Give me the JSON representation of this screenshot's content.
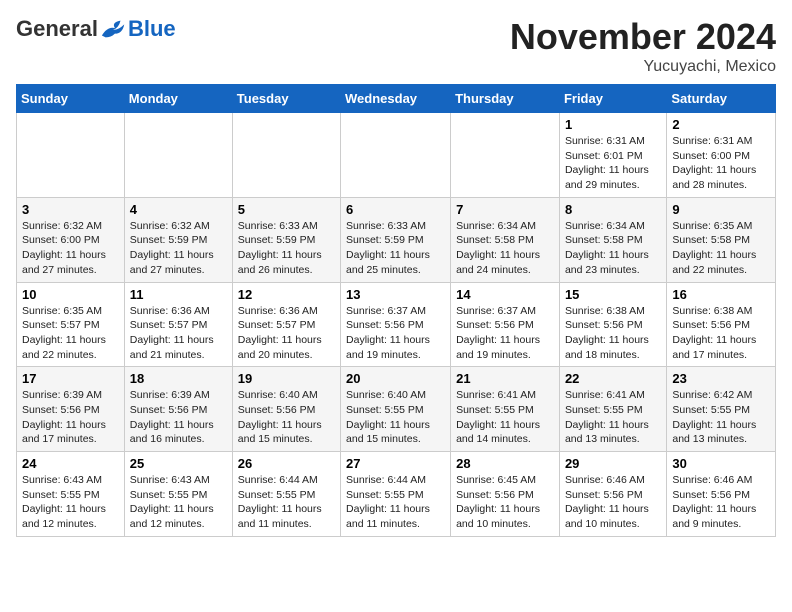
{
  "logo": {
    "general": "General",
    "blue": "Blue"
  },
  "title": "November 2024",
  "location": "Yucuyachi, Mexico",
  "days_header": [
    "Sunday",
    "Monday",
    "Tuesday",
    "Wednesday",
    "Thursday",
    "Friday",
    "Saturday"
  ],
  "weeks": [
    [
      {
        "day": "",
        "info": ""
      },
      {
        "day": "",
        "info": ""
      },
      {
        "day": "",
        "info": ""
      },
      {
        "day": "",
        "info": ""
      },
      {
        "day": "",
        "info": ""
      },
      {
        "day": "1",
        "info": "Sunrise: 6:31 AM\nSunset: 6:01 PM\nDaylight: 11 hours and 29 minutes."
      },
      {
        "day": "2",
        "info": "Sunrise: 6:31 AM\nSunset: 6:00 PM\nDaylight: 11 hours and 28 minutes."
      }
    ],
    [
      {
        "day": "3",
        "info": "Sunrise: 6:32 AM\nSunset: 6:00 PM\nDaylight: 11 hours and 27 minutes."
      },
      {
        "day": "4",
        "info": "Sunrise: 6:32 AM\nSunset: 5:59 PM\nDaylight: 11 hours and 27 minutes."
      },
      {
        "day": "5",
        "info": "Sunrise: 6:33 AM\nSunset: 5:59 PM\nDaylight: 11 hours and 26 minutes."
      },
      {
        "day": "6",
        "info": "Sunrise: 6:33 AM\nSunset: 5:59 PM\nDaylight: 11 hours and 25 minutes."
      },
      {
        "day": "7",
        "info": "Sunrise: 6:34 AM\nSunset: 5:58 PM\nDaylight: 11 hours and 24 minutes."
      },
      {
        "day": "8",
        "info": "Sunrise: 6:34 AM\nSunset: 5:58 PM\nDaylight: 11 hours and 23 minutes."
      },
      {
        "day": "9",
        "info": "Sunrise: 6:35 AM\nSunset: 5:58 PM\nDaylight: 11 hours and 22 minutes."
      }
    ],
    [
      {
        "day": "10",
        "info": "Sunrise: 6:35 AM\nSunset: 5:57 PM\nDaylight: 11 hours and 22 minutes."
      },
      {
        "day": "11",
        "info": "Sunrise: 6:36 AM\nSunset: 5:57 PM\nDaylight: 11 hours and 21 minutes."
      },
      {
        "day": "12",
        "info": "Sunrise: 6:36 AM\nSunset: 5:57 PM\nDaylight: 11 hours and 20 minutes."
      },
      {
        "day": "13",
        "info": "Sunrise: 6:37 AM\nSunset: 5:56 PM\nDaylight: 11 hours and 19 minutes."
      },
      {
        "day": "14",
        "info": "Sunrise: 6:37 AM\nSunset: 5:56 PM\nDaylight: 11 hours and 19 minutes."
      },
      {
        "day": "15",
        "info": "Sunrise: 6:38 AM\nSunset: 5:56 PM\nDaylight: 11 hours and 18 minutes."
      },
      {
        "day": "16",
        "info": "Sunrise: 6:38 AM\nSunset: 5:56 PM\nDaylight: 11 hours and 17 minutes."
      }
    ],
    [
      {
        "day": "17",
        "info": "Sunrise: 6:39 AM\nSunset: 5:56 PM\nDaylight: 11 hours and 17 minutes."
      },
      {
        "day": "18",
        "info": "Sunrise: 6:39 AM\nSunset: 5:56 PM\nDaylight: 11 hours and 16 minutes."
      },
      {
        "day": "19",
        "info": "Sunrise: 6:40 AM\nSunset: 5:56 PM\nDaylight: 11 hours and 15 minutes."
      },
      {
        "day": "20",
        "info": "Sunrise: 6:40 AM\nSunset: 5:55 PM\nDaylight: 11 hours and 15 minutes."
      },
      {
        "day": "21",
        "info": "Sunrise: 6:41 AM\nSunset: 5:55 PM\nDaylight: 11 hours and 14 minutes."
      },
      {
        "day": "22",
        "info": "Sunrise: 6:41 AM\nSunset: 5:55 PM\nDaylight: 11 hours and 13 minutes."
      },
      {
        "day": "23",
        "info": "Sunrise: 6:42 AM\nSunset: 5:55 PM\nDaylight: 11 hours and 13 minutes."
      }
    ],
    [
      {
        "day": "24",
        "info": "Sunrise: 6:43 AM\nSunset: 5:55 PM\nDaylight: 11 hours and 12 minutes."
      },
      {
        "day": "25",
        "info": "Sunrise: 6:43 AM\nSunset: 5:55 PM\nDaylight: 11 hours and 12 minutes."
      },
      {
        "day": "26",
        "info": "Sunrise: 6:44 AM\nSunset: 5:55 PM\nDaylight: 11 hours and 11 minutes."
      },
      {
        "day": "27",
        "info": "Sunrise: 6:44 AM\nSunset: 5:55 PM\nDaylight: 11 hours and 11 minutes."
      },
      {
        "day": "28",
        "info": "Sunrise: 6:45 AM\nSunset: 5:56 PM\nDaylight: 11 hours and 10 minutes."
      },
      {
        "day": "29",
        "info": "Sunrise: 6:46 AM\nSunset: 5:56 PM\nDaylight: 11 hours and 10 minutes."
      },
      {
        "day": "30",
        "info": "Sunrise: 6:46 AM\nSunset: 5:56 PM\nDaylight: 11 hours and 9 minutes."
      }
    ]
  ]
}
